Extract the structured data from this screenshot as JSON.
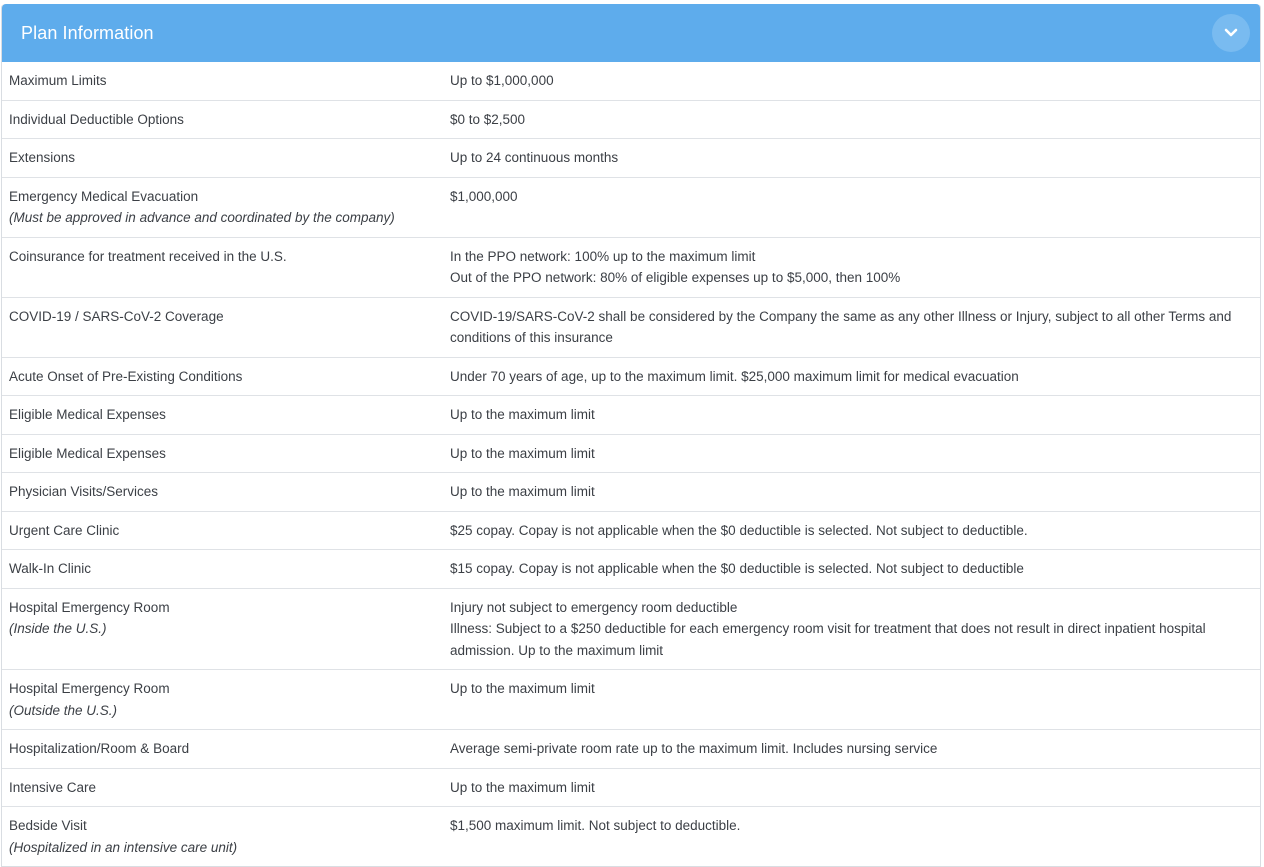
{
  "header": {
    "title": "Plan Information",
    "toggle_icon": "chevron-down-icon"
  },
  "colors": {
    "header_bg": "#5eacec",
    "toggle_bg": "#79bbf0",
    "text": "#3b3f45"
  },
  "rows": [
    {
      "label": "Maximum Limits",
      "note": "",
      "values": [
        "Up to $1,000,000"
      ]
    },
    {
      "label": "Individual Deductible Options",
      "note": "",
      "values": [
        "$0 to $2,500"
      ]
    },
    {
      "label": "Extensions",
      "note": "",
      "values": [
        "Up to 24 continuous months"
      ]
    },
    {
      "label": "Emergency Medical Evacuation",
      "note": "(Must be approved in advance and coordinated by the company)",
      "values": [
        "$1,000,000"
      ]
    },
    {
      "label": "Coinsurance for treatment received in the U.S.",
      "note": "",
      "values": [
        "In the PPO network: 100% up to the maximum limit",
        "Out of the PPO network: 80% of eligible expenses up to $5,000, then 100%"
      ]
    },
    {
      "label": "COVID-19 / SARS-CoV-2 Coverage",
      "note": "",
      "values": [
        "COVID-19/SARS-CoV-2 shall be considered by the Company the same as any other Illness or Injury, subject to all other Terms and conditions of this insurance"
      ]
    },
    {
      "label": "Acute Onset of Pre-Existing Conditions",
      "note": "",
      "values": [
        "Under 70 years of age, up to the maximum limit. $25,000 maximum limit for medical evacuation"
      ]
    },
    {
      "label": "Eligible Medical Expenses",
      "note": "",
      "values": [
        "Up to the maximum limit"
      ]
    },
    {
      "label": "Eligible Medical Expenses",
      "note": "",
      "values": [
        "Up to the maximum limit"
      ]
    },
    {
      "label": "Physician Visits/Services",
      "note": "",
      "values": [
        "Up to the maximum limit"
      ]
    },
    {
      "label": "Urgent Care Clinic",
      "note": "",
      "values": [
        "$25 copay. Copay is not applicable when the $0 deductible is selected. Not subject to deductible."
      ]
    },
    {
      "label": "Walk-In Clinic",
      "note": "",
      "values": [
        "$15 copay. Copay is not applicable when the $0 deductible is selected. Not subject to deductible"
      ]
    },
    {
      "label": "Hospital Emergency Room",
      "note": "(Inside the U.S.)",
      "values": [
        "Injury not subject to emergency room deductible",
        "Illness: Subject to a $250 deductible for each emergency room visit for treatment that does not result in direct inpatient hospital admission. Up to the maximum limit"
      ]
    },
    {
      "label": "Hospital Emergency Room",
      "note": "(Outside the U.S.)",
      "values": [
        "Up to the maximum limit"
      ]
    },
    {
      "label": "Hospitalization/Room & Board",
      "note": "",
      "values": [
        "Average semi-private room rate up to the maximum limit. Includes nursing service"
      ]
    },
    {
      "label": "Intensive Care",
      "note": "",
      "values": [
        "Up to the maximum limit"
      ]
    },
    {
      "label": "Bedside Visit",
      "note": "(Hospitalized in an intensive care unit)",
      "values": [
        "$1,500 maximum limit. Not subject to deductible."
      ]
    }
  ]
}
